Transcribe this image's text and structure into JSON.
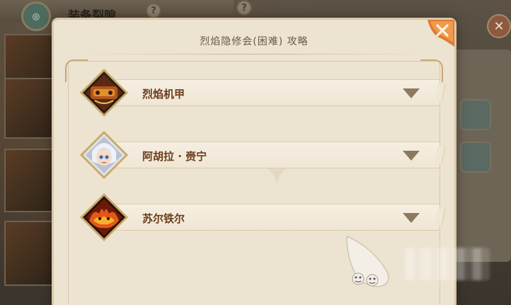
{
  "background": {
    "title": "装备裂隙",
    "help_glyph": "?",
    "close_glyph": "✕"
  },
  "dialog": {
    "title": "烈焰隐修会(困难) 攻略",
    "close_glyph": "✕"
  },
  "bosses": [
    {
      "name": "烈焰机甲",
      "icon": "flame-mech-portrait"
    },
    {
      "name": "阿胡拉 · 赍宁",
      "icon": "silver-hair-girl-portrait"
    },
    {
      "name": "苏尔铁尔",
      "icon": "fire-demon-portrait"
    }
  ],
  "colors": {
    "dialog_bg": "#ece3d1",
    "label_text": "#6b3d1c",
    "chevron": "#8a7a60",
    "close_accent": "#e07a35"
  }
}
